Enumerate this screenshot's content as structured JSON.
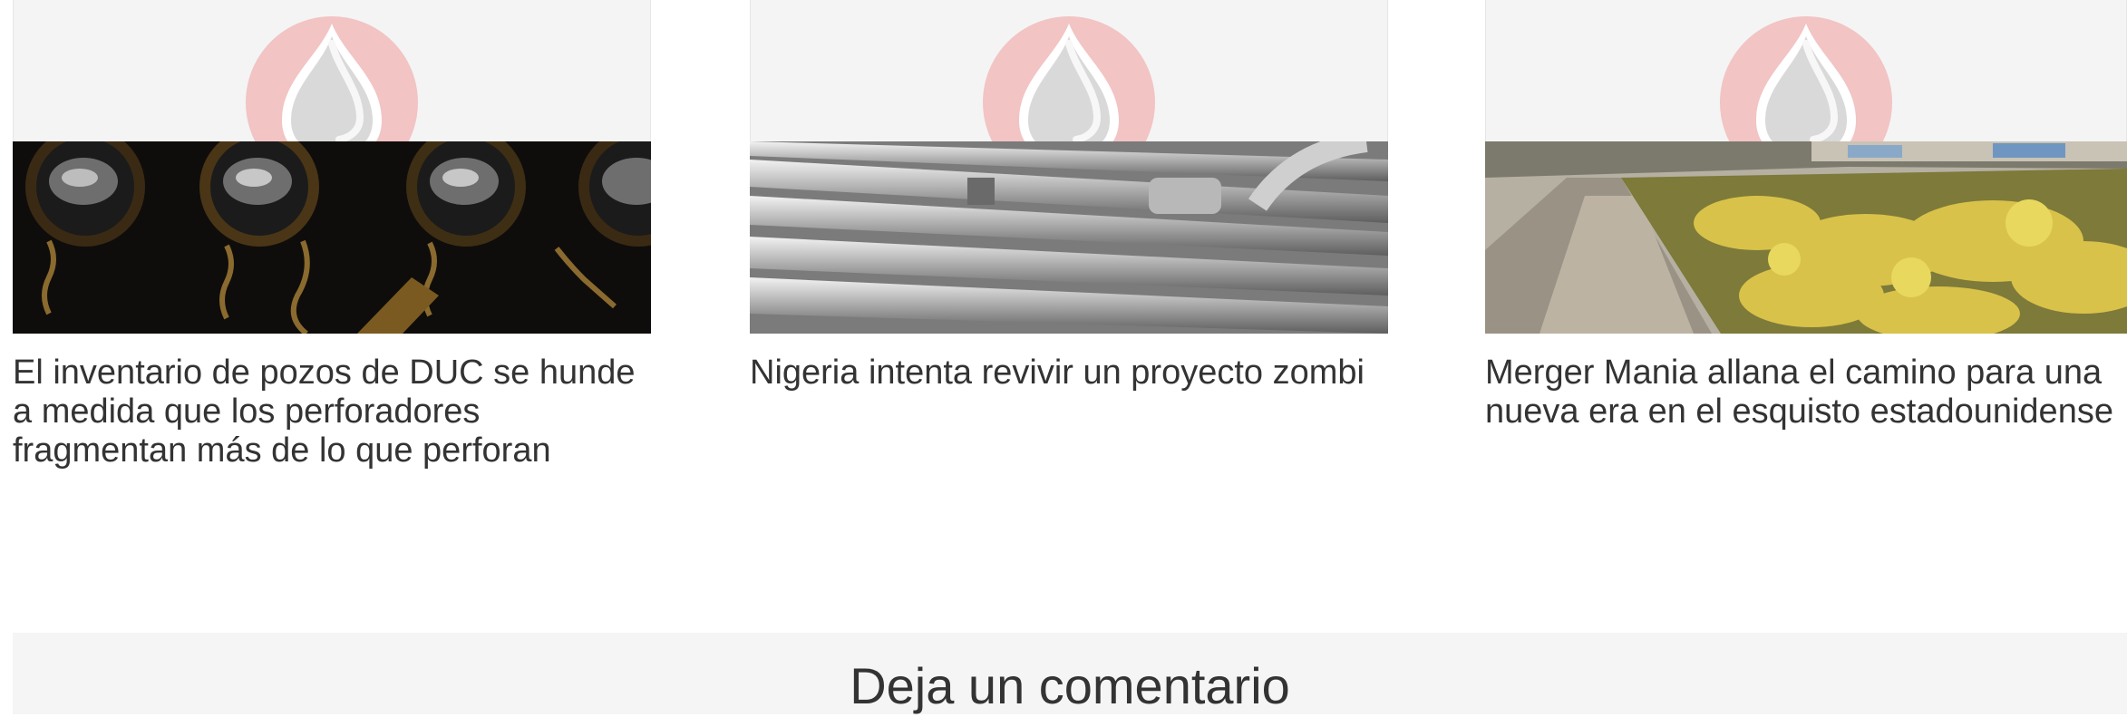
{
  "related_articles": [
    {
      "title": "El inventario de pozos de DUC se hunde a medida que los perforadores fragmentan más de lo que perforan",
      "photo_icon": "oil-hose-valves-photo"
    },
    {
      "title": "Nigeria intenta revivir un proyecto zombi",
      "photo_icon": "steel-pipelines-photo"
    },
    {
      "title": "Merger Mania allana el camino para una nueva era en el esquisto estadounidense",
      "photo_icon": "dirt-road-landscape-photo"
    }
  ],
  "placeholder_icon": "oil-drop-logo-icon",
  "colors": {
    "placeholder_circle": "#f2c4c4",
    "title_text": "#333333",
    "comment_bg": "#f5f5f5"
  },
  "comments": {
    "heading": "Deja un comentario"
  }
}
